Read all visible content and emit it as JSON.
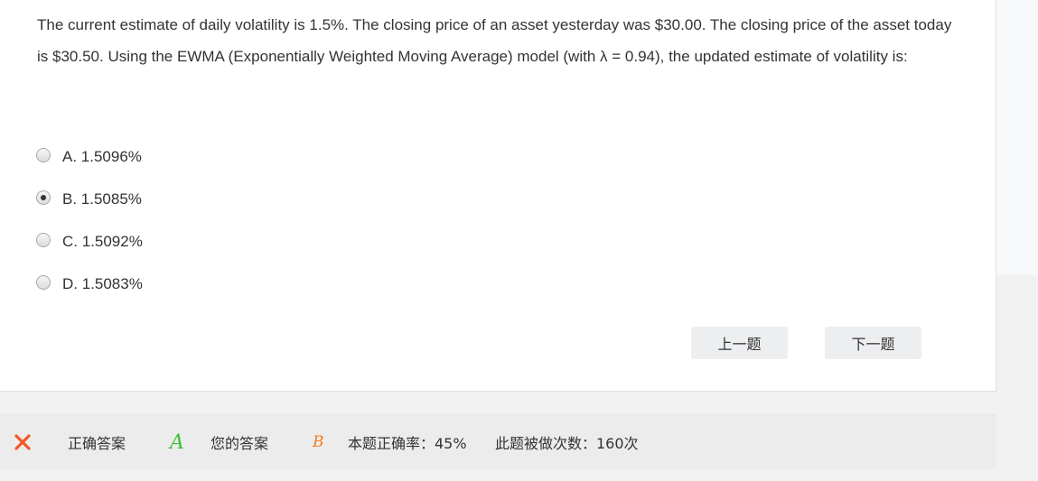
{
  "question": {
    "text": "The current estimate of daily volatility is 1.5%. The closing price of an asset yesterday was $30.00. The closing price of the asset today is $30.50. Using the EWMA (Exponentially Weighted Moving Average) model (with λ = 0.94), the updated estimate of volatility is:"
  },
  "options": [
    {
      "label": "A. 1.5096%",
      "checked": false
    },
    {
      "label": "B. 1.5085%",
      "checked": true
    },
    {
      "label": "C. 1.5092%",
      "checked": false
    },
    {
      "label": "D. 1.5083%",
      "checked": false
    }
  ],
  "nav": {
    "prev_label": "上一题",
    "next_label": "下一题"
  },
  "result": {
    "status_icon": "close-icon",
    "status_color": "#f15a24",
    "correct_label": "正确答案",
    "correct_value": "A",
    "correct_color": "#3fbf3a",
    "your_label": "您的答案",
    "your_value": "B",
    "your_color": "#f07c20",
    "rate_text": "本题正确率：45%",
    "count_text": "此题被做次数：160次"
  }
}
